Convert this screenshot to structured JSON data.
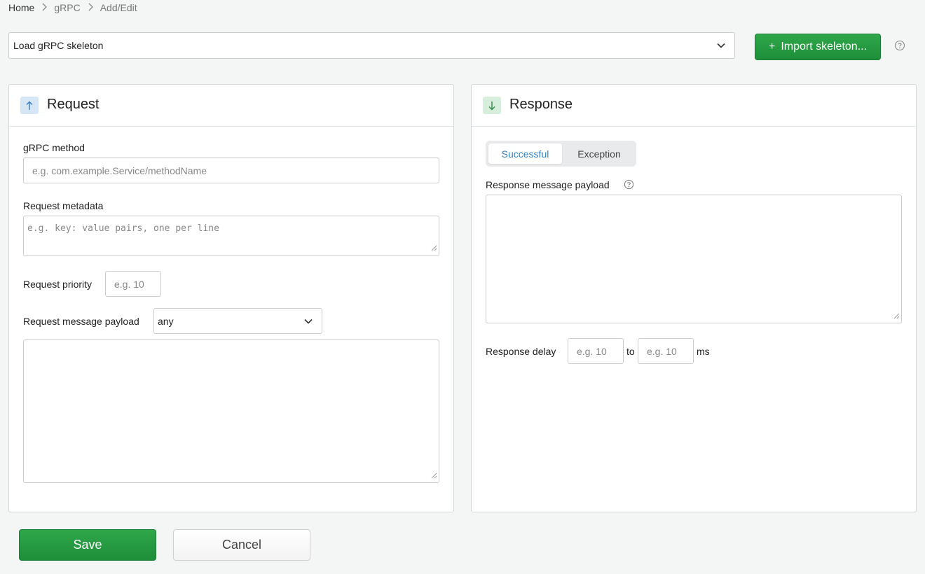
{
  "breadcrumb": {
    "home": "Home",
    "section": "gRPC",
    "current": "Add/Edit"
  },
  "skeleton": {
    "select_label": "Load gRPC skeleton",
    "import_label": "Import skeleton..."
  },
  "request": {
    "title": "Request",
    "method_label": "gRPC method",
    "method_placeholder": "e.g. com.example.Service/methodName",
    "metadata_label": "Request metadata",
    "metadata_placeholder": "e.g. key: value pairs, one per line",
    "priority_label": "Request priority",
    "priority_placeholder": "e.g. 10",
    "payload_label": "Request message payload",
    "payload_match": "any",
    "payload_value": ""
  },
  "response": {
    "title": "Response",
    "tabs": [
      "Successful",
      "Exception"
    ],
    "active_tab": "Successful",
    "payload_label": "Response message payload",
    "payload_value": "",
    "delay_label": "Response delay",
    "delay_min_placeholder": "e.g. 10",
    "delay_to": "to",
    "delay_max_placeholder": "e.g. 10",
    "delay_unit": "ms"
  },
  "actions": {
    "save": "Save",
    "cancel": "Cancel"
  },
  "colors": {
    "primary_green": "#1e8e3a",
    "active_tab_blue": "#2f7fc1",
    "request_badge": "#d6e6f5",
    "response_badge": "#d8eedd"
  },
  "icons": {
    "breadcrumb_separator": "chevron-right-icon",
    "dropdown": "chevron-down-icon",
    "help": "help-circle-icon",
    "request": "arrow-up-icon",
    "response": "arrow-down-icon"
  }
}
